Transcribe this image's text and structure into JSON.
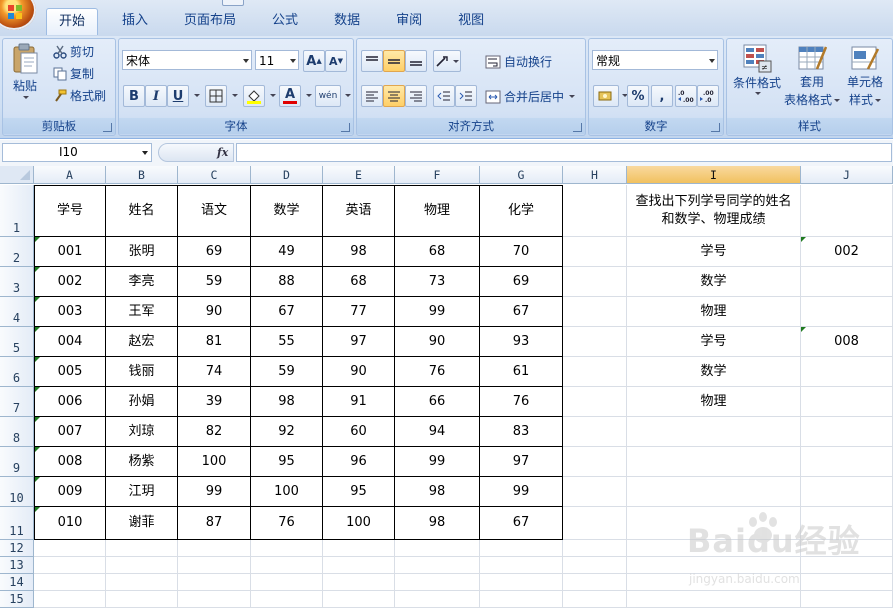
{
  "tabs": [
    "开始",
    "插入",
    "页面布局",
    "公式",
    "数据",
    "审阅",
    "视图"
  ],
  "ribbon": {
    "clipboard": {
      "label": "剪贴板",
      "paste": "粘贴",
      "cut": "剪切",
      "copy": "复制",
      "format_painter": "格式刷"
    },
    "font": {
      "label": "字体",
      "font_name": "宋体",
      "font_size": "11",
      "bold": "B",
      "italic": "I",
      "underline": "U",
      "font_color_letter": "A",
      "phonetic": "wén"
    },
    "alignment": {
      "label": "对齐方式",
      "wrap_text": "自动换行",
      "merge_center": "合并后居中"
    },
    "number": {
      "label": "数字",
      "format": "常规",
      "percent": "%",
      "comma": ","
    },
    "styles": {
      "label": "样式",
      "conditional": "条件格式",
      "table_line1": "套用",
      "table_line2": "表格格式",
      "cell_line1": "单元格",
      "cell_line2": "样式"
    }
  },
  "formula_bar": {
    "name_box": "I10",
    "fx": "fx",
    "content": ""
  },
  "grid": {
    "columns": [
      "A",
      "B",
      "C",
      "D",
      "E",
      "F",
      "G",
      "H",
      "I",
      "J"
    ],
    "rows": [
      "1",
      "2",
      "3",
      "4",
      "5",
      "6",
      "7",
      "8",
      "9",
      "10",
      "11",
      "12",
      "13",
      "14",
      "15"
    ],
    "headers": [
      "学号",
      "姓名",
      "语文",
      "数学",
      "英语",
      "物理",
      "化学"
    ],
    "records": [
      [
        "001",
        "张明",
        "69",
        "49",
        "98",
        "68",
        "70"
      ],
      [
        "002",
        "李亮",
        "59",
        "88",
        "68",
        "73",
        "69"
      ],
      [
        "003",
        "王军",
        "90",
        "67",
        "77",
        "99",
        "67"
      ],
      [
        "004",
        "赵宏",
        "81",
        "55",
        "97",
        "90",
        "93"
      ],
      [
        "005",
        "钱丽",
        "74",
        "59",
        "90",
        "76",
        "61"
      ],
      [
        "006",
        "孙娟",
        "39",
        "98",
        "91",
        "66",
        "76"
      ],
      [
        "007",
        "刘琼",
        "82",
        "92",
        "60",
        "94",
        "83"
      ],
      [
        "008",
        "杨紫",
        "100",
        "95",
        "96",
        "99",
        "97"
      ],
      [
        "009",
        "江玥",
        "99",
        "100",
        "95",
        "98",
        "99"
      ],
      [
        "010",
        "谢菲",
        "87",
        "76",
        "100",
        "98",
        "67"
      ]
    ],
    "lookup_title": "查找出下列学号同学的姓名和数学、物理成绩",
    "lookup_labels": [
      "学号",
      "数学",
      "物理",
      "学号",
      "数学",
      "物理"
    ],
    "lookup_ids": [
      "002",
      "008"
    ]
  },
  "watermark": {
    "name": "Baidu经验",
    "url": "jingyan.baidu.com"
  },
  "colors": {
    "ribbon": "#d3e1f4",
    "selected_header": "#f1c15f",
    "triangle": "#1f7a1f"
  }
}
